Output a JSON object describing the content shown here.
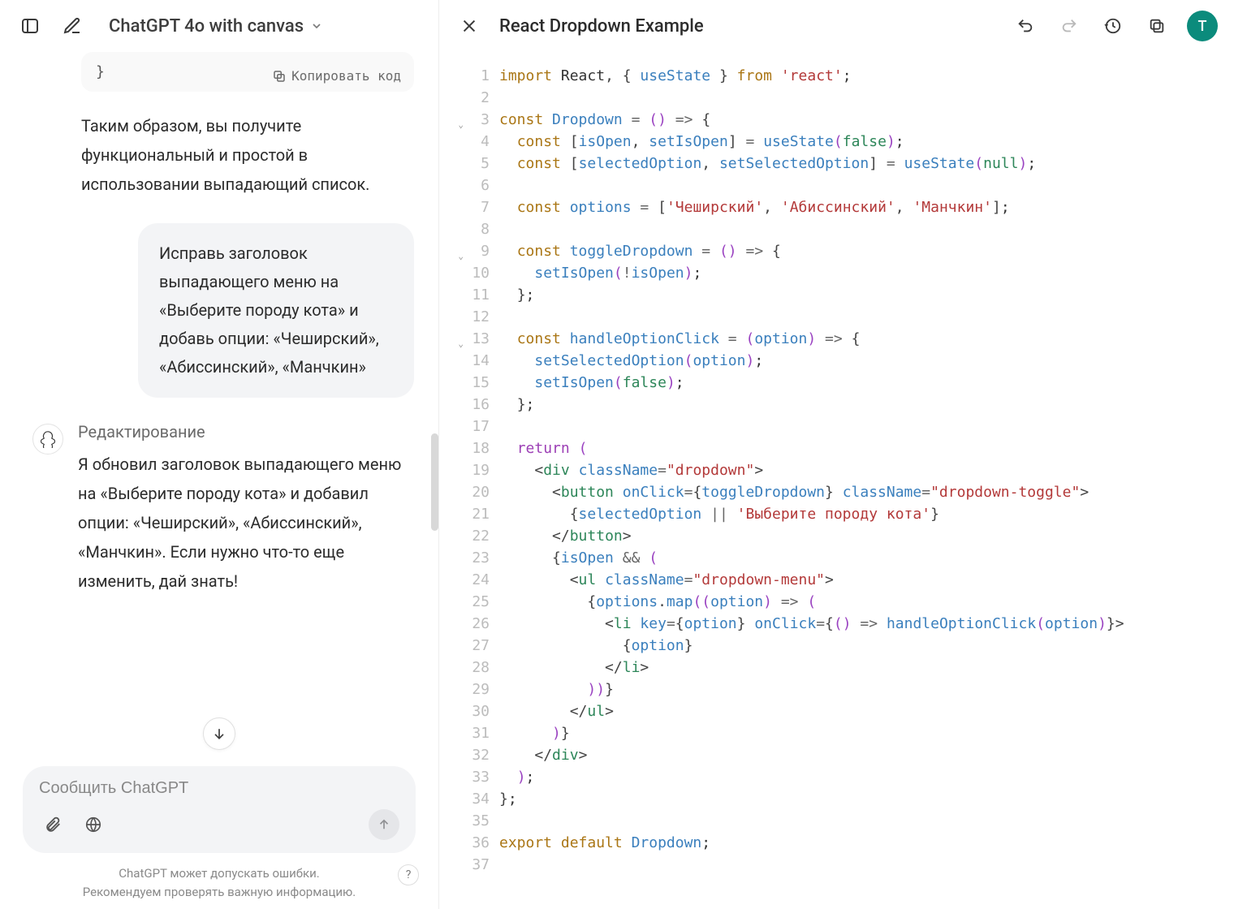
{
  "header": {
    "model_label": "ChatGPT 4o with canvas"
  },
  "chat": {
    "code_tail": "}",
    "copy_code_label": "Копировать код",
    "assistant_summary": "Таким образом, вы получите функциональный и простой в использовании выпадающий список.",
    "user_message": "Исправь заголовок выпадающего меню на «Выберите породу кота» и добавь опции: «Чеширский», «Абиссинский», «Манчкин»",
    "edit_heading": "Редактирование",
    "edit_text": "Я обновил заголовок выпадающего меню на «Выберите породу кота» и добавил опции: «Чеширский», «Абиссинский», «Манчкин». Если нужно что-то еще изменить, дай знать!",
    "input_placeholder": "Сообщить ChatGPT",
    "disclaimer_line1": "ChatGPT может допускать ошибки.",
    "disclaimer_line2": "Рекомендуем проверять важную информацию.",
    "help_label": "?"
  },
  "canvas": {
    "title": "React Dropdown Example",
    "avatar_letter": "T"
  },
  "code": {
    "line_count": 37,
    "fold_lines": [
      3,
      9,
      13
    ],
    "lines": [
      {
        "t": "import",
        "k": "kw"
      },
      {
        "t": " React, { ",
        "k": ""
      },
      {
        "t": "useState",
        "k": "fn"
      },
      {
        "t": " } ",
        "k": ""
      },
      {
        "t": "from",
        "k": "kw"
      },
      {
        "t": " ",
        "k": ""
      },
      {
        "t": "'react'",
        "k": "str"
      },
      {
        "t": ";",
        "k": ""
      }
    ],
    "l1": "import React, { useState } from 'react';",
    "l3": "const Dropdown = () => {",
    "l4": "  const [isOpen, setIsOpen] = useState(false);",
    "l5": "  const [selectedOption, setSelectedOption] = useState(null);",
    "l7": "  const options = ['Чеширский', 'Абиссинский', 'Манчкин'];",
    "l9": "  const toggleDropdown = () => {",
    "l10": "    setIsOpen(!isOpen);",
    "l11": "  };",
    "l13": "  const handleOptionClick = (option) => {",
    "l14": "    setSelectedOption(option);",
    "l15": "    setIsOpen(false);",
    "l16": "  };",
    "l18": "  return (",
    "l19": "    <div className=\"dropdown\">",
    "l20": "      <button onClick={toggleDropdown} className=\"dropdown-toggle\">",
    "l21": "        {selectedOption || 'Выберите породу кота'}",
    "l22": "      </button>",
    "l23": "      {isOpen && (",
    "l24": "        <ul className=\"dropdown-menu\">",
    "l25": "          {options.map((option) => (",
    "l26": "            <li key={option} onClick={() => handleOptionClick(option)}>",
    "l27": "              {option}",
    "l28": "            </li>",
    "l29": "          ))}",
    "l30": "        </ul>",
    "l31": "      )}",
    "l32": "    </div>",
    "l33": "  );",
    "l34": "};",
    "l36": "export default Dropdown;"
  }
}
